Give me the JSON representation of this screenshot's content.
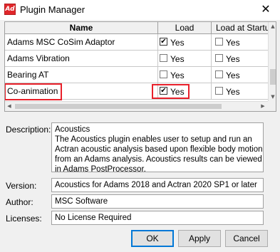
{
  "window": {
    "title": "Plugin Manager",
    "icon_text": "Ad",
    "close_glyph": "✕"
  },
  "grid": {
    "columns": [
      "Name",
      "Load",
      "Load at Startup"
    ],
    "rows": [
      {
        "name": "Adams MSC CoSim Adaptor",
        "load_checked": true,
        "load_label": "Yes",
        "startup_checked": false,
        "startup_label": "Yes"
      },
      {
        "name": "Adams Vibration",
        "load_checked": false,
        "load_label": "Yes",
        "startup_checked": false,
        "startup_label": "Yes"
      },
      {
        "name": "Bearing AT",
        "load_checked": false,
        "load_label": "Yes",
        "startup_checked": false,
        "startup_label": "Yes"
      },
      {
        "name": "Co-animation",
        "load_checked": true,
        "load_label": "Yes",
        "startup_checked": false,
        "startup_label": "Yes"
      }
    ],
    "highlight_color": "#e8202a"
  },
  "details": {
    "description_label": "Description:",
    "description_lines": [
      "Acoustics",
      "The Acoustics plugin enables user to setup and run an",
      "Actran acoustic analysis based upon flexible body motion",
      "from an Adams analysis. Acoustics results can be viewed",
      "in Adams PostProcessor."
    ],
    "version_label": "Version:",
    "version_value": "Acoustics for Adams 2018 and Actran 2020 SP1 or later",
    "author_label": "Author:",
    "author_value": "MSC Software",
    "licenses_label": "Licenses:",
    "licenses_value": "No License Required"
  },
  "buttons": {
    "ok": "OK",
    "apply": "Apply",
    "cancel": "Cancel"
  }
}
